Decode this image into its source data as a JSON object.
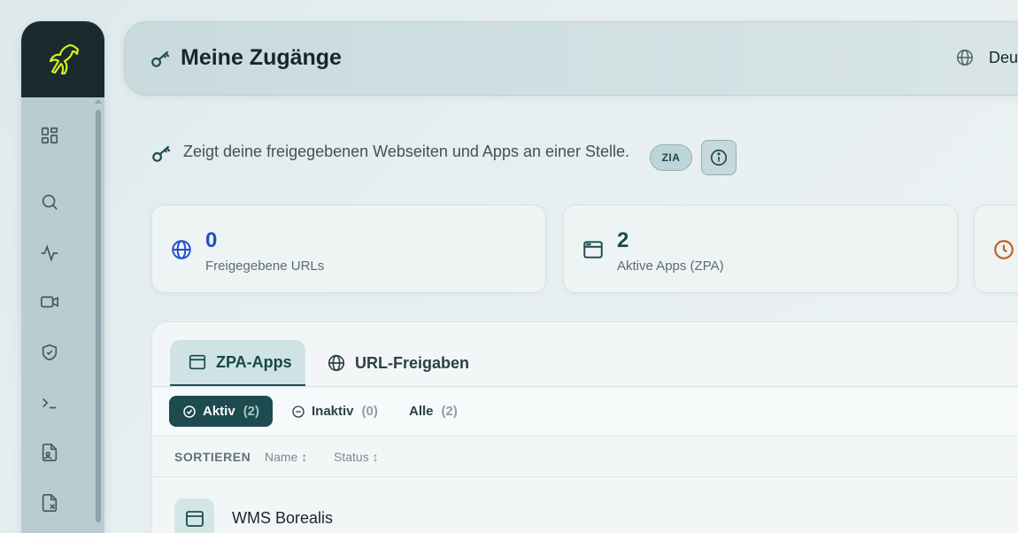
{
  "sidebar": {
    "logo": "horse-logo",
    "items": [
      {
        "icon": "dashboard-icon"
      },
      {
        "icon": "search-icon"
      },
      {
        "icon": "activity-icon"
      },
      {
        "icon": "video-icon"
      },
      {
        "icon": "shield-check-icon"
      },
      {
        "icon": "terminal-icon"
      },
      {
        "icon": "file-user-icon"
      },
      {
        "icon": "file-x-icon"
      }
    ]
  },
  "header": {
    "title": "Meine Zugänge",
    "language": "Deu"
  },
  "description": {
    "text": "Zeigt deine freigegebenen Webseiten und Apps an einer Stelle.",
    "badge": "ZIA"
  },
  "stats": [
    {
      "value": "0",
      "label": "Freigegebene URLs",
      "color": "#1f4fc9",
      "icon": "globe-icon"
    },
    {
      "value": "2",
      "label": "Aktive Apps (ZPA)",
      "color": "#1d4b4f",
      "icon": "app-window-icon"
    },
    {
      "value": "",
      "label": "",
      "color": "#c0601c",
      "icon": "clock-icon"
    }
  ],
  "tabs": [
    {
      "label": "ZPA-Apps",
      "active": true
    },
    {
      "label": "URL-Freigaben",
      "active": false
    }
  ],
  "filters": [
    {
      "label": "Aktiv",
      "count": "(2)",
      "active": true
    },
    {
      "label": "Inaktiv",
      "count": "(0)",
      "active": false
    },
    {
      "label": "Alle",
      "count": "(2)",
      "active": false
    }
  ],
  "sort": {
    "label": "SORTIEREN",
    "options": [
      "Name ↕",
      "Status ↕"
    ]
  },
  "apps": [
    {
      "name": "WMS Borealis"
    }
  ],
  "colors": {
    "accent": "#1d4b4f",
    "logo": "#d4f01c"
  }
}
